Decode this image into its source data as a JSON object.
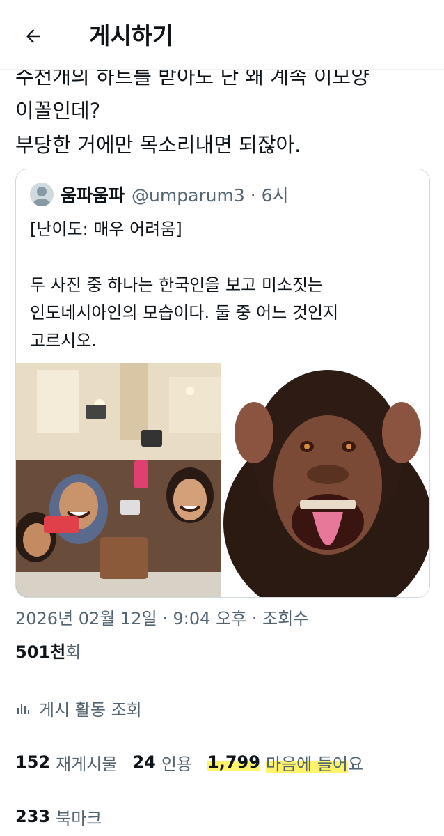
{
  "header": {
    "title": "게시하기",
    "back_icon": "arrow-left-icon"
  },
  "tweet": {
    "lines": [
      "수천개의 하트를 받아도 난 왜 계속 이모양",
      "이꼴인데?",
      "부당한 거에만 목소리내면 되잖아."
    ]
  },
  "quote": {
    "name": "움파움파",
    "handle": "@umparum3 · 6시",
    "body": "[난이도: 매우 어려움]\n\n두 사진 중 하나는 한국인을 보고 미소짓는\n인도네시아인의 모습이다. 둘 중 어느 것인지\n고르시오."
  },
  "meta": {
    "timestamp": "2026년 02월 12일 · 9:04 오후 · 조회수",
    "views_count": "501천",
    "views_suffix": "회"
  },
  "activity": {
    "label": "게시 활동 조회",
    "icon": "bar-chart-icon"
  },
  "stats": {
    "reposts_count": "152",
    "reposts_label": "재게시물",
    "quotes_count": "24",
    "quotes_label": "인용",
    "likes_count": "1,799",
    "likes_label_highlight": "마음에 들어",
    "likes_label_rest": "요",
    "bookmarks_count": "233",
    "bookmarks_label": "북마크"
  },
  "colors": {
    "text": "#0f1419",
    "secondary": "#536471",
    "border": "#cfd9de",
    "highlight": "#fff36b"
  }
}
